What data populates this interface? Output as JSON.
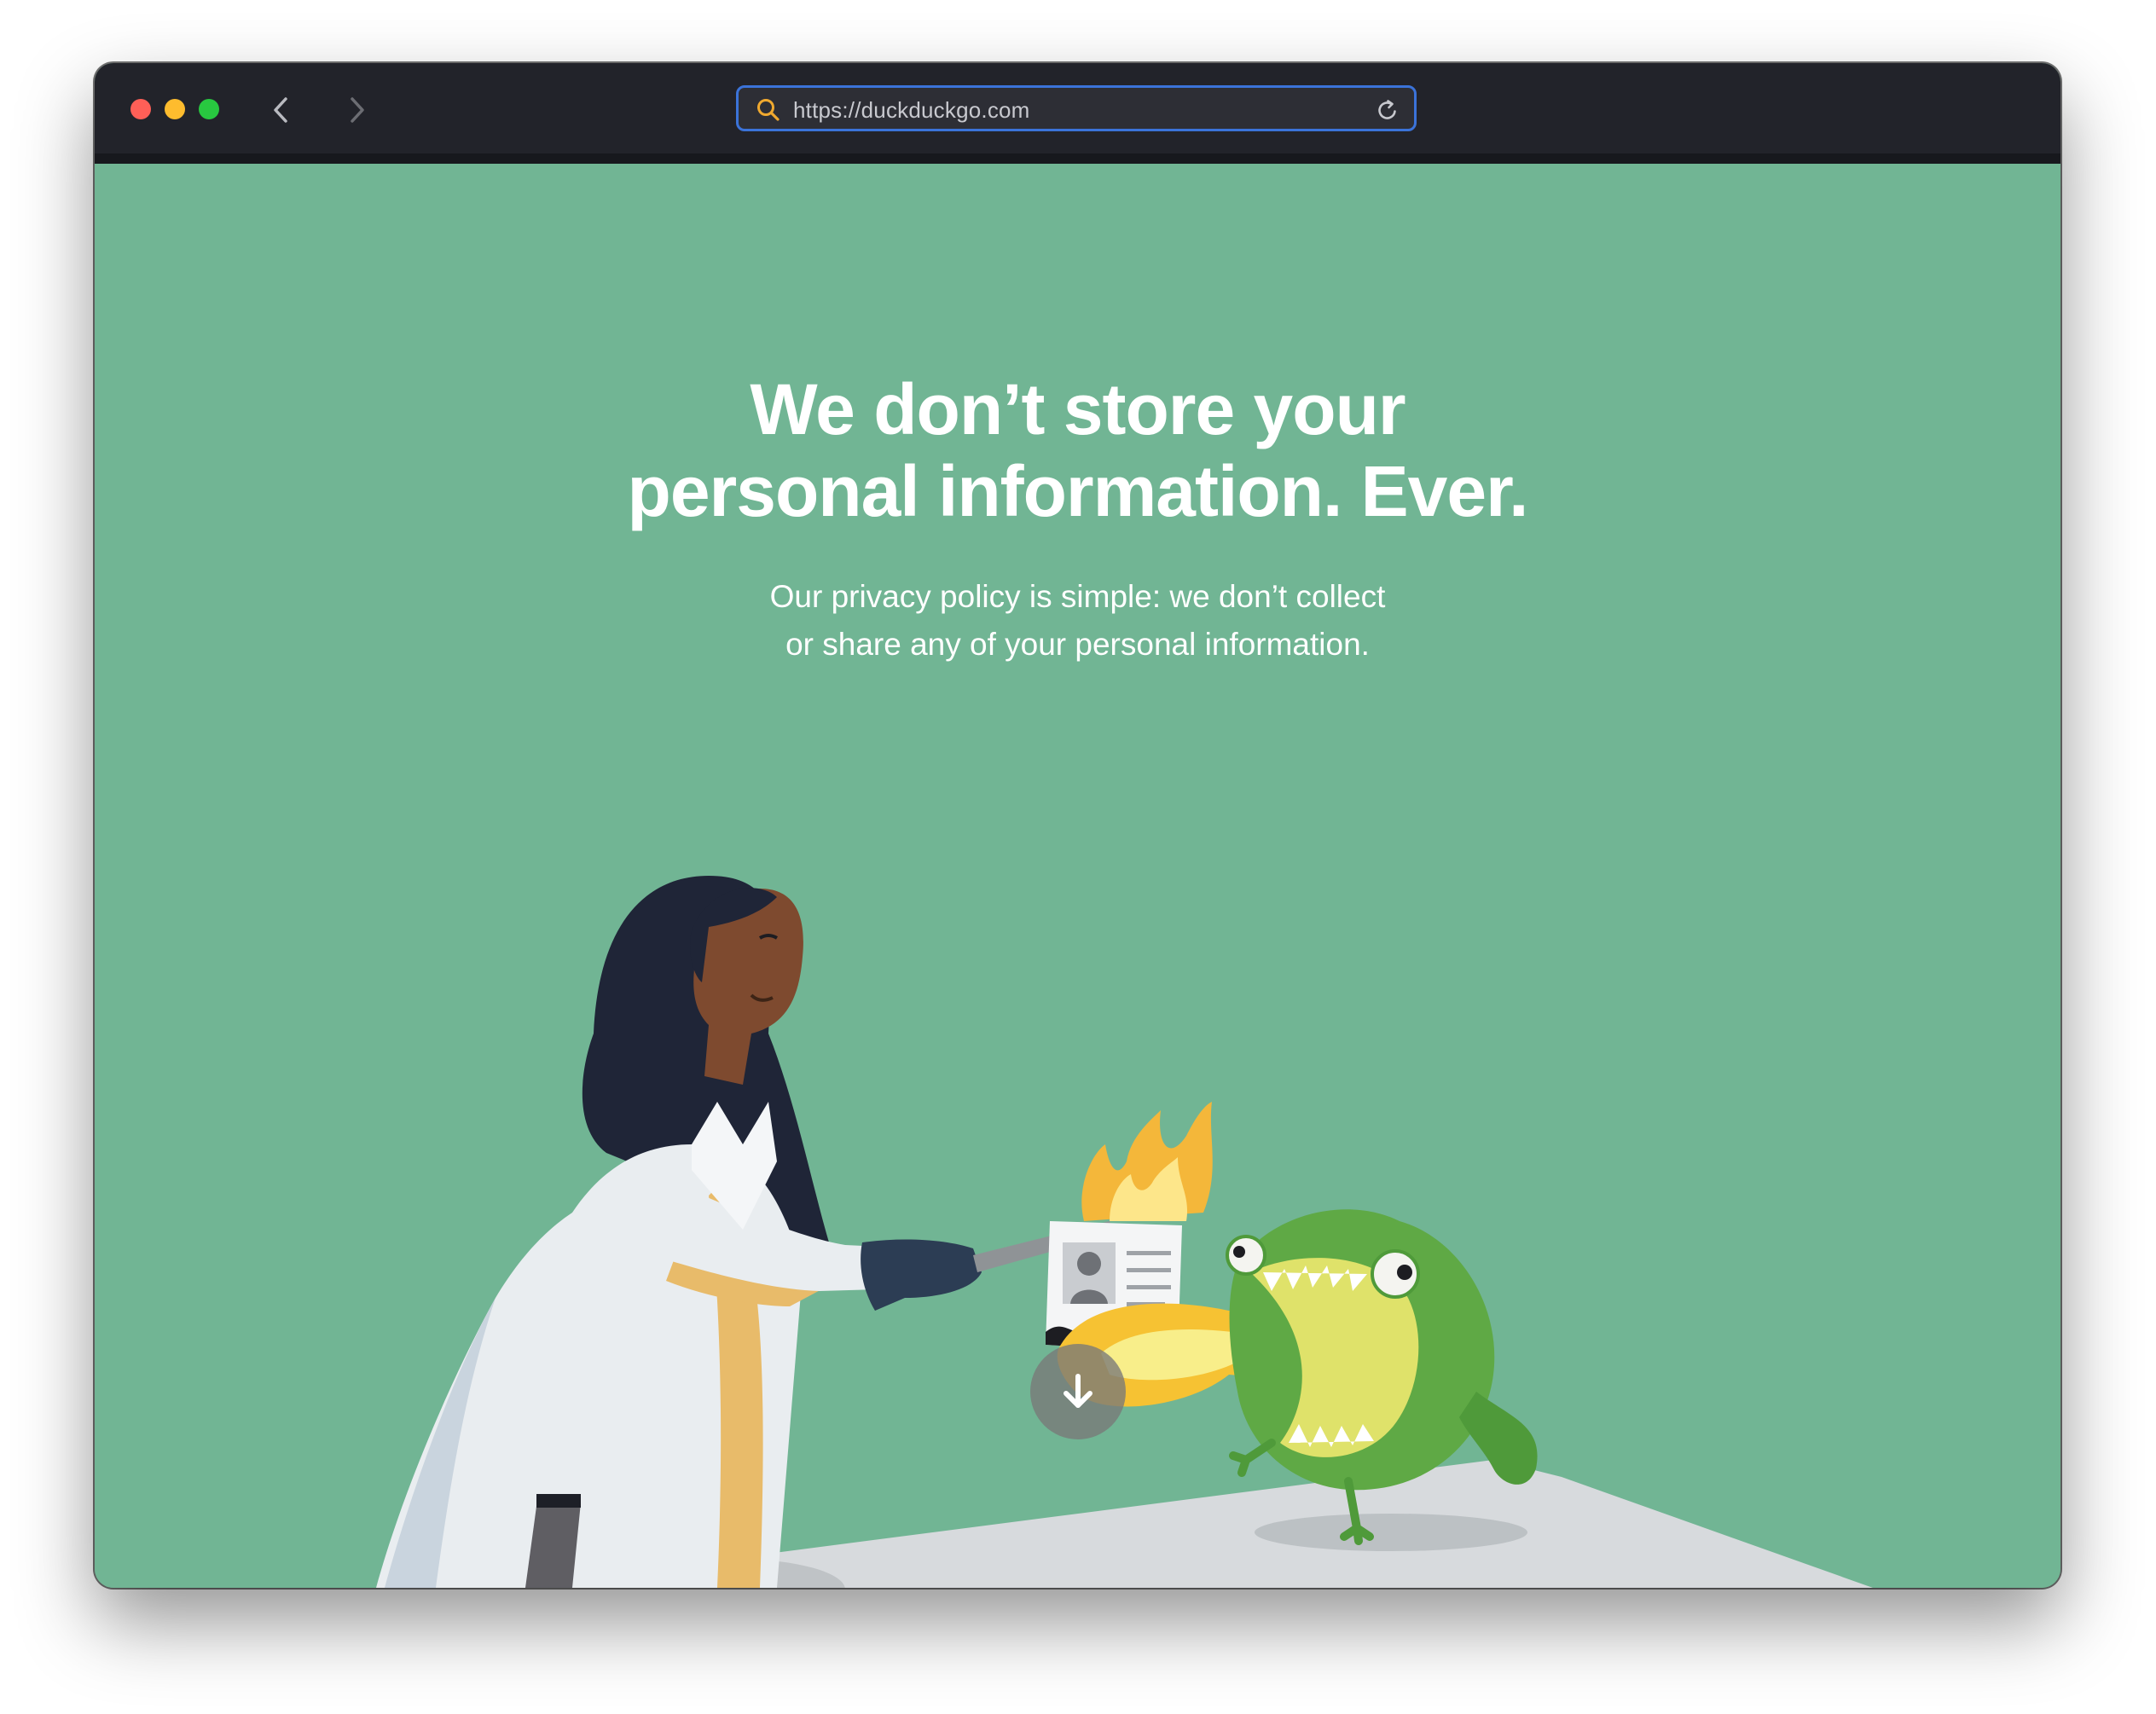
{
  "browser": {
    "url": "https://duckduckgo.com",
    "traffic_colors": {
      "close": "#fe5f57",
      "minimize": "#febc2e",
      "zoom": "#28c840"
    }
  },
  "page": {
    "headline_line1": "We don’t store your",
    "headline_line2": "personal information. Ever.",
    "subtext_line1": "Our privacy policy is simple: we don’t collect",
    "subtext_line2": "or share any of your personal information.",
    "background_color": "#71b594"
  },
  "icons": {
    "back": "chevron-left-icon",
    "forward": "chevron-right-icon",
    "search": "search-icon",
    "reload": "reload-icon",
    "scroll": "arrow-down-icon"
  }
}
